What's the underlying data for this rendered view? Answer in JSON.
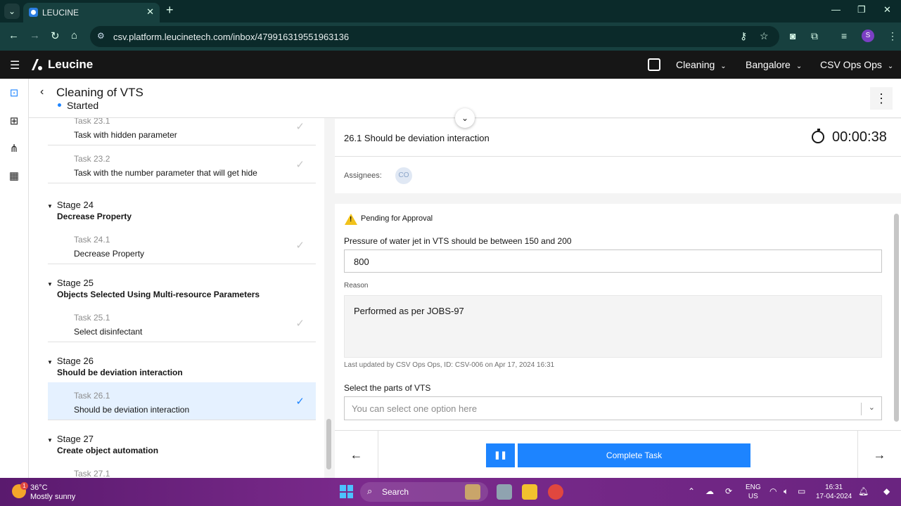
{
  "browser": {
    "tab_title": "LEUCINE",
    "url": "csv.platform.leucinetech.com/inbox/479916319551963136",
    "profile_initial": "S"
  },
  "header": {
    "brand": "Leucine",
    "facility_dropdown": "Cleaning",
    "location_dropdown": "Bangalore",
    "user_dropdown": "CSV Ops Ops"
  },
  "page": {
    "title": "Cleaning of VTS",
    "status": "Started"
  },
  "tasklist": {
    "items": [
      {
        "kind": "task",
        "number": "Task 23.1",
        "name": "Task with hidden parameter",
        "active": false
      },
      {
        "kind": "task",
        "number": "Task 23.2",
        "name": "Task with the number parameter that will get hide",
        "active": false
      },
      {
        "kind": "stage",
        "number": "Stage 24",
        "name": "Decrease Property"
      },
      {
        "kind": "task",
        "number": "Task 24.1",
        "name": "Decrease Property",
        "active": false
      },
      {
        "kind": "stage",
        "number": "Stage 25",
        "name": "Objects Selected Using Multi-resource Parameters"
      },
      {
        "kind": "task",
        "number": "Task 25.1",
        "name": "Select disinfectant",
        "active": false
      },
      {
        "kind": "stage",
        "number": "Stage 26",
        "name": "Should be deviation interaction"
      },
      {
        "kind": "task",
        "number": "Task 26.1",
        "name": "Should be deviation interaction",
        "active": true
      },
      {
        "kind": "stage",
        "number": "Stage 27",
        "name": "Create object automation"
      },
      {
        "kind": "task",
        "number": "Task 27.1",
        "name": "",
        "active": false
      }
    ]
  },
  "task": {
    "title": "26.1 Should be deviation interaction",
    "timer": "00:00:38",
    "assignees_label": "Assignees:",
    "assignee_initials": "CO",
    "pending_text": "Pending for Approval",
    "param_label": "Pressure of water jet in VTS should be between 150 and 200",
    "param_value": "800",
    "reason_label": "Reason",
    "reason_text": "Performed as per JOBS-97",
    "last_updated": "Last updated by CSV Ops Ops, ID: CSV-006 on Apr 17, 2024 16:31",
    "select_label": "Select the parts of VTS",
    "select_placeholder": "You can select one option here",
    "complete_label": "Complete Task"
  },
  "taskbar": {
    "temperature": "36°C",
    "weather": "Mostly sunny",
    "weather_badge": "1",
    "search_label": "Search",
    "lang_line1": "ENG",
    "lang_line2": "US",
    "time": "16:31",
    "date": "17-04-2024"
  },
  "colors": {
    "primary": "#1d84ff",
    "header_bg": "#161616",
    "warning": "#f1c21b",
    "active_task_bg": "#e5f1ff"
  }
}
